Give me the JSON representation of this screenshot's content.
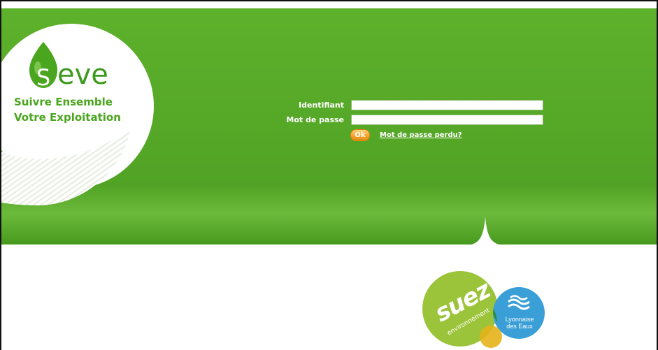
{
  "brand": {
    "drop_letter": "S",
    "name_rest": "eve",
    "tagline_line1": "Suivre Ensemble",
    "tagline_line2": "Votre Exploitation"
  },
  "login": {
    "username_label": "Identifiant",
    "username_value": "",
    "password_label": "Mot de passe",
    "password_value": "",
    "submit_label": "Ok",
    "lost_password_link": "Mot de passe perdu?"
  },
  "partners": {
    "suez_name": "suez",
    "suez_sub": "environnement",
    "lyonnaise_line1": "Lyonnaise",
    "lyonnaise_line2": "des Eaux"
  },
  "colors": {
    "green_main": "#5aad29",
    "green_dark": "#3d9a1f",
    "orange_button": "#f2a12b",
    "suez_green": "#9cc43a",
    "lyonnaise_blue": "#3a9fd6"
  }
}
